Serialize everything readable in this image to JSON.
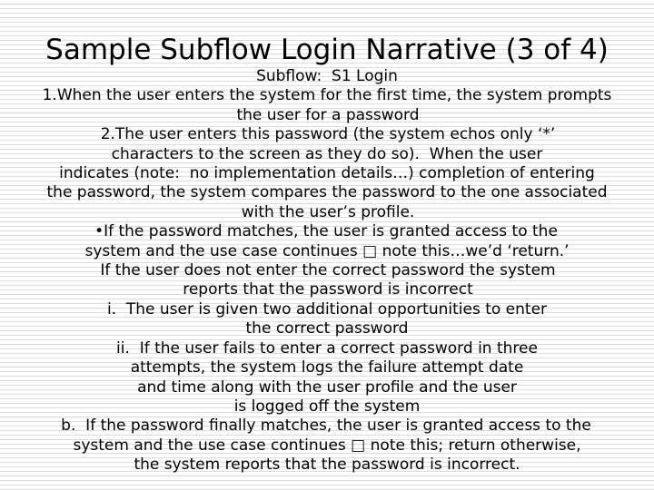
{
  "slide": {
    "title": "Sample Subflow Login Narrative (3 of 4)",
    "page_label": "3 of 4",
    "background_color": "#ffffff",
    "text_color": "#000000",
    "scanline_color": "#dcdcdc"
  },
  "body": {
    "lines": [
      {
        "id": "l01",
        "text": "Subflow:  S1 Login"
      },
      {
        "id": "l02",
        "text": "1.When the user enters the system for the first time, the system prompts"
      },
      {
        "id": "l03",
        "text": "the user for a password"
      },
      {
        "id": "l04",
        "text": "2.The user enters this password (the system echos only ‘*’"
      },
      {
        "id": "l05",
        "text": "characters to the screen as they do so).  When the user"
      },
      {
        "id": "l06",
        "text": "indicates (note:  no implementation details…) completion of entering"
      },
      {
        "id": "l07",
        "text": "the password, the system compares the password to the one associated"
      },
      {
        "id": "l08",
        "text": "with the user’s profile."
      },
      {
        "id": "l09",
        "text": "•If the password matches, the user is granted access to the"
      },
      {
        "id": "l10",
        "text": "system and the use case continues □ note this…we’d ‘return.’"
      },
      {
        "id": "l11",
        "text": "If the user does not enter the correct password the system"
      },
      {
        "id": "l12",
        "text": "reports that the password is incorrect"
      },
      {
        "id": "l13",
        "text": "i.  The user is given two additional opportunities to enter"
      },
      {
        "id": "l14",
        "text": "the correct password"
      },
      {
        "id": "l15",
        "text": "ii.  If the user fails to enter a correct password in three"
      },
      {
        "id": "l16",
        "text": "attempts, the system logs the failure attempt date"
      },
      {
        "id": "l17",
        "text": "and time along with the user profile and the user"
      },
      {
        "id": "l18",
        "text": "is logged off the system"
      },
      {
        "id": "l19",
        "text": "b.  If the password finally matches, the user is granted access to the"
      },
      {
        "id": "l20",
        "text": "system and the use case continues □ note this; return otherwise,"
      },
      {
        "id": "l21",
        "text": "the system reports that the password is incorrect."
      }
    ]
  }
}
